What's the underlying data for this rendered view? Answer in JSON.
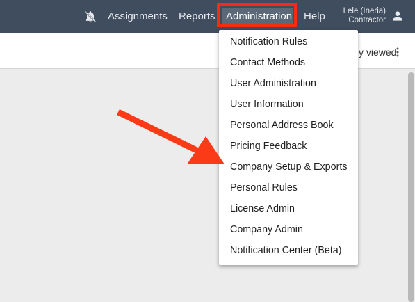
{
  "topbar": {
    "bell_icon": "bell-off-icon",
    "items": [
      "Assignments",
      "Reports",
      "Administration",
      "Help"
    ],
    "user": {
      "name": "Lele (Ineria)",
      "role": "Contractor",
      "icon": "person-icon"
    },
    "highlight_color": "#f72b12"
  },
  "subbar": {
    "recent_label": "y viewed",
    "menu_icon": "kebab-icon"
  },
  "admin_menu": {
    "items": [
      "Notification Rules",
      "Contact Methods",
      "User Administration",
      "User Information",
      "Personal Address Book",
      "Pricing Feedback",
      "Company Setup & Exports",
      "Personal Rules",
      "License Admin",
      "Company Admin",
      "Notification Center (Beta)"
    ]
  },
  "annotation": {
    "arrow_color": "#fb3a17",
    "arrow_icon": "arrow-annotation-icon"
  }
}
